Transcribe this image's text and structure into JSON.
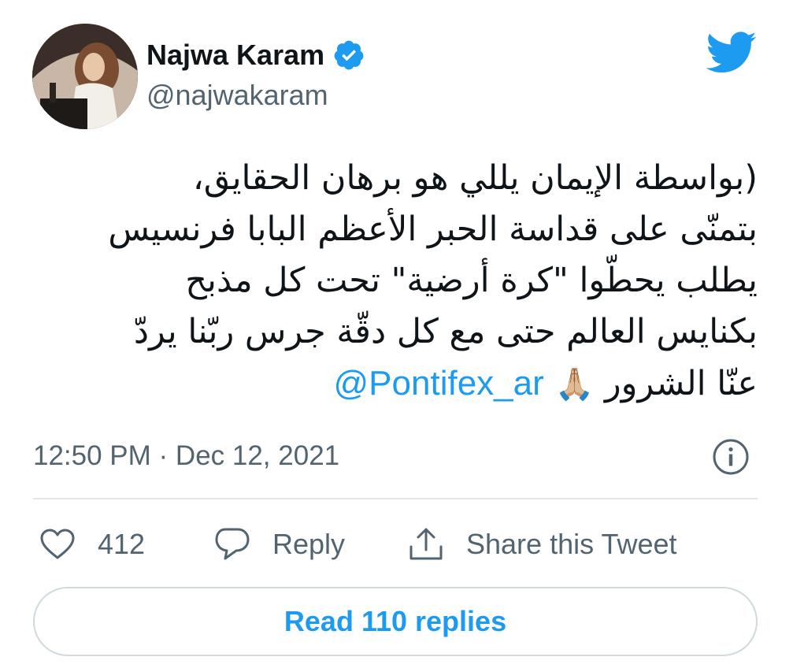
{
  "author": {
    "display_name": "Najwa Karam",
    "handle": "@najwakaram"
  },
  "tweet": {
    "lines": [
      "(بواسطة الإيمان يللي هو برهان الحقايق،",
      "بتمنّى على قداسة الحبر الأعظم البابا فرنسيس",
      "يطلب يحطّوا \"كرة أرضية\" تحت كل مذبح",
      "بكنايس العالم حتى مع كل دقّة جرس ربّنا يردّ"
    ],
    "last_line_text": "عنّا الشرور",
    "emoji": "🙏🏼",
    "mention": "@Pontifex_ar"
  },
  "timestamp": "12:50 PM · Dec 12, 2021",
  "actions": {
    "like_count": "412",
    "reply_label": "Reply",
    "share_label": "Share this Tweet"
  },
  "read_replies_label": "Read 110 replies",
  "colors": {
    "accent": "#1d9bf0",
    "secondary_text": "#536471",
    "primary_text": "#0f1419",
    "divider": "#e1e6ea"
  },
  "icons": {
    "logo": "twitter-bird-icon",
    "verified": "verified-badge-icon",
    "info": "info-icon",
    "like": "heart-icon",
    "reply": "speech-bubble-icon",
    "share": "share-upload-icon"
  }
}
